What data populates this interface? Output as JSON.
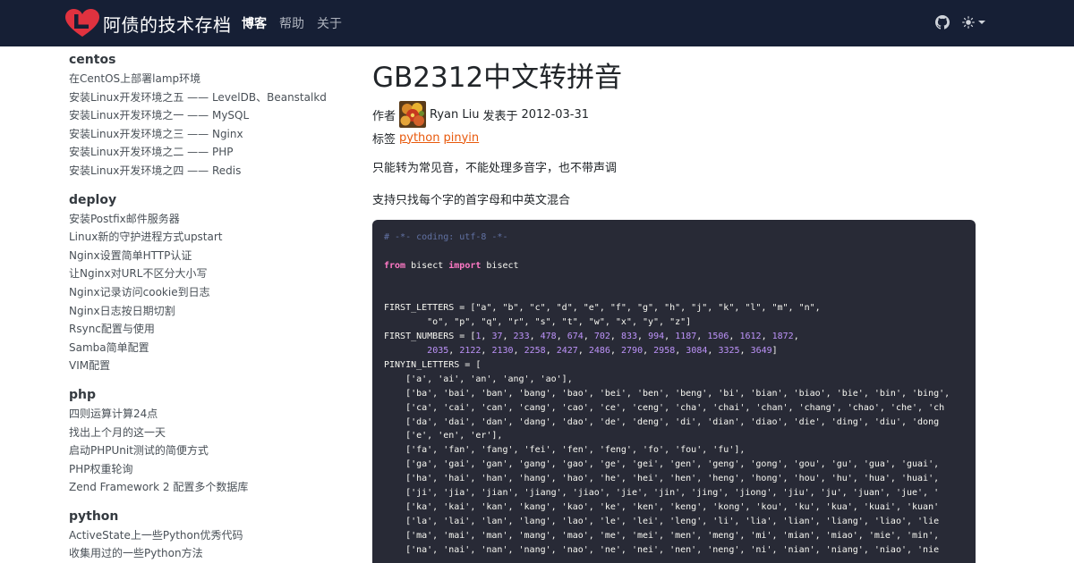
{
  "site": {
    "brand": "阿债的技术存档",
    "nav": [
      {
        "label": "博客",
        "active": true
      },
      {
        "label": "帮助",
        "active": false
      },
      {
        "label": "关于",
        "active": false
      }
    ],
    "icons": {
      "logo": "heart-L-logo",
      "github": "github-icon",
      "theme": "sun-icon"
    },
    "colors": {
      "navbar_bg": "#161f35",
      "logo_red": "#e0323f",
      "tag_link": "#e8590c",
      "code_bg": "#282a36"
    }
  },
  "sidebar": {
    "categories": [
      {
        "name": "centos",
        "items": [
          "在CentOS上部署lamp环境",
          "安装Linux开发环境之五 —— LevelDB、Beanstalkd",
          "安装Linux开发环境之一 —— MySQL",
          "安装Linux开发环境之三 —— Nginx",
          "安装Linux开发环境之二 —— PHP",
          "安装Linux开发环境之四 —— Redis"
        ]
      },
      {
        "name": "deploy",
        "items": [
          "安装Postfix邮件服务器",
          "Linux新的守护进程方式upstart",
          "Nginx设置简单HTTP认证",
          "让Nginx对URL不区分大小写",
          "Nginx记录访问cookie到日志",
          "Nginx日志按日期切割",
          "Rsync配置与使用",
          "Samba简单配置",
          "VIM配置"
        ]
      },
      {
        "name": "php",
        "items": [
          "四则运算计算24点",
          "找出上个月的这一天",
          "启动PHPUnit测试的简便方式",
          "PHP权重轮询",
          "Zend Framework 2 配置多个数据库"
        ]
      },
      {
        "name": "python",
        "items": [
          "ActiveState上一些Python优秀代码",
          "收集用过的一些Python方法"
        ]
      }
    ]
  },
  "post": {
    "title": "GB2312中文转拼音",
    "author_label": "作者",
    "author": "Ryan Liu",
    "published_label": "发表于",
    "date": "2012-03-31",
    "tags_label": "标签",
    "tags": [
      "python",
      "pinyin"
    ],
    "paragraphs": [
      "只能转为常见音，不能处理多音字，也不带声调",
      "支持只找每个字的首字母和中英文混合"
    ],
    "code_lines": [
      [
        {
          "t": "comment",
          "s": "# -*- coding: utf-8 -*-"
        }
      ],
      [],
      [
        {
          "t": "kw",
          "s": "from"
        },
        {
          "t": "plain",
          "s": " bisect "
        },
        {
          "t": "kw",
          "s": "import"
        },
        {
          "t": "plain",
          "s": " bisect"
        }
      ],
      [],
      [],
      [
        {
          "t": "plain",
          "s": "FIRST_LETTERS = [\"a\", \"b\", \"c\", \"d\", \"e\", \"f\", \"g\", \"h\", \"j\", \"k\", \"l\", \"m\", \"n\","
        }
      ],
      [
        {
          "t": "plain",
          "s": "        \"o\", \"p\", \"q\", \"r\", \"s\", \"t\", \"w\", \"x\", \"y\", \"z\"]"
        }
      ],
      [
        {
          "t": "plain",
          "s": "FIRST_NUMBERS = ["
        },
        {
          "t": "num",
          "s": "1"
        },
        {
          "t": "plain",
          "s": ", "
        },
        {
          "t": "num",
          "s": "37"
        },
        {
          "t": "plain",
          "s": ", "
        },
        {
          "t": "num",
          "s": "233"
        },
        {
          "t": "plain",
          "s": ", "
        },
        {
          "t": "num",
          "s": "478"
        },
        {
          "t": "plain",
          "s": ", "
        },
        {
          "t": "num",
          "s": "674"
        },
        {
          "t": "plain",
          "s": ", "
        },
        {
          "t": "num",
          "s": "702"
        },
        {
          "t": "plain",
          "s": ", "
        },
        {
          "t": "num",
          "s": "833"
        },
        {
          "t": "plain",
          "s": ", "
        },
        {
          "t": "num",
          "s": "994"
        },
        {
          "t": "plain",
          "s": ", "
        },
        {
          "t": "num",
          "s": "1187"
        },
        {
          "t": "plain",
          "s": ", "
        },
        {
          "t": "num",
          "s": "1506"
        },
        {
          "t": "plain",
          "s": ", "
        },
        {
          "t": "num",
          "s": "1612"
        },
        {
          "t": "plain",
          "s": ", "
        },
        {
          "t": "num",
          "s": "1872"
        },
        {
          "t": "plain",
          "s": ","
        }
      ],
      [
        {
          "t": "plain",
          "s": "        "
        },
        {
          "t": "num",
          "s": "2035"
        },
        {
          "t": "plain",
          "s": ", "
        },
        {
          "t": "num",
          "s": "2122"
        },
        {
          "t": "plain",
          "s": ", "
        },
        {
          "t": "num",
          "s": "2130"
        },
        {
          "t": "plain",
          "s": ", "
        },
        {
          "t": "num",
          "s": "2258"
        },
        {
          "t": "plain",
          "s": ", "
        },
        {
          "t": "num",
          "s": "2427"
        },
        {
          "t": "plain",
          "s": ", "
        },
        {
          "t": "num",
          "s": "2486"
        },
        {
          "t": "plain",
          "s": ", "
        },
        {
          "t": "num",
          "s": "2790"
        },
        {
          "t": "plain",
          "s": ", "
        },
        {
          "t": "num",
          "s": "2958"
        },
        {
          "t": "plain",
          "s": ", "
        },
        {
          "t": "num",
          "s": "3084"
        },
        {
          "t": "plain",
          "s": ", "
        },
        {
          "t": "num",
          "s": "3325"
        },
        {
          "t": "plain",
          "s": ", "
        },
        {
          "t": "num",
          "s": "3649"
        },
        {
          "t": "plain",
          "s": "]"
        }
      ],
      [
        {
          "t": "plain",
          "s": "PINYIN_LETTERS = ["
        }
      ],
      [
        {
          "t": "plain",
          "s": "    ['a', 'ai', 'an', 'ang', 'ao'],"
        }
      ],
      [
        {
          "t": "plain",
          "s": "    ['ba', 'bai', 'ban', 'bang', 'bao', 'bei', 'ben', 'beng', 'bi', 'bian', 'biao', 'bie', 'bin', 'bing',"
        }
      ],
      [
        {
          "t": "plain",
          "s": "    ['ca', 'cai', 'can', 'cang', 'cao', 'ce', 'ceng', 'cha', 'chai', 'chan', 'chang', 'chao', 'che', 'ch"
        }
      ],
      [
        {
          "t": "plain",
          "s": "    ['da', 'dai', 'dan', 'dang', 'dao', 'de', 'deng', 'di', 'dian', 'diao', 'die', 'ding', 'diu', 'dong"
        }
      ],
      [
        {
          "t": "plain",
          "s": "    ['e', 'en', 'er'],"
        }
      ],
      [
        {
          "t": "plain",
          "s": "    ['fa', 'fan', 'fang', 'fei', 'fen', 'feng', 'fo', 'fou', 'fu'],"
        }
      ],
      [
        {
          "t": "plain",
          "s": "    ['ga', 'gai', 'gan', 'gang', 'gao', 'ge', 'gei', 'gen', 'geng', 'gong', 'gou', 'gu', 'gua', 'guai',"
        }
      ],
      [
        {
          "t": "plain",
          "s": "    ['ha', 'hai', 'han', 'hang', 'hao', 'he', 'hei', 'hen', 'heng', 'hong', 'hou', 'hu', 'hua', 'huai',"
        }
      ],
      [
        {
          "t": "plain",
          "s": "    ['ji', 'jia', 'jian', 'jiang', 'jiao', 'jie', 'jin', 'jing', 'jiong', 'jiu', 'ju', 'juan', 'jue', '"
        }
      ],
      [
        {
          "t": "plain",
          "s": "    ['ka', 'kai', 'kan', 'kang', 'kao', 'ke', 'ken', 'keng', 'kong', 'kou', 'ku', 'kua', 'kuai', 'kuan'"
        }
      ],
      [
        {
          "t": "plain",
          "s": "    ['la', 'lai', 'lan', 'lang', 'lao', 'le', 'lei', 'leng', 'li', 'lia', 'lian', 'liang', 'liao', 'lie"
        }
      ],
      [
        {
          "t": "plain",
          "s": "    ['ma', 'mai', 'man', 'mang', 'mao', 'me', 'mei', 'men', 'meng', 'mi', 'mian', 'miao', 'mie', 'min',"
        }
      ],
      [
        {
          "t": "plain",
          "s": "    ['na', 'nai', 'nan', 'nang', 'nao', 'ne', 'nei', 'nen', 'neng', 'ni', 'nian', 'niang', 'niao', 'nie"
        }
      ]
    ]
  }
}
